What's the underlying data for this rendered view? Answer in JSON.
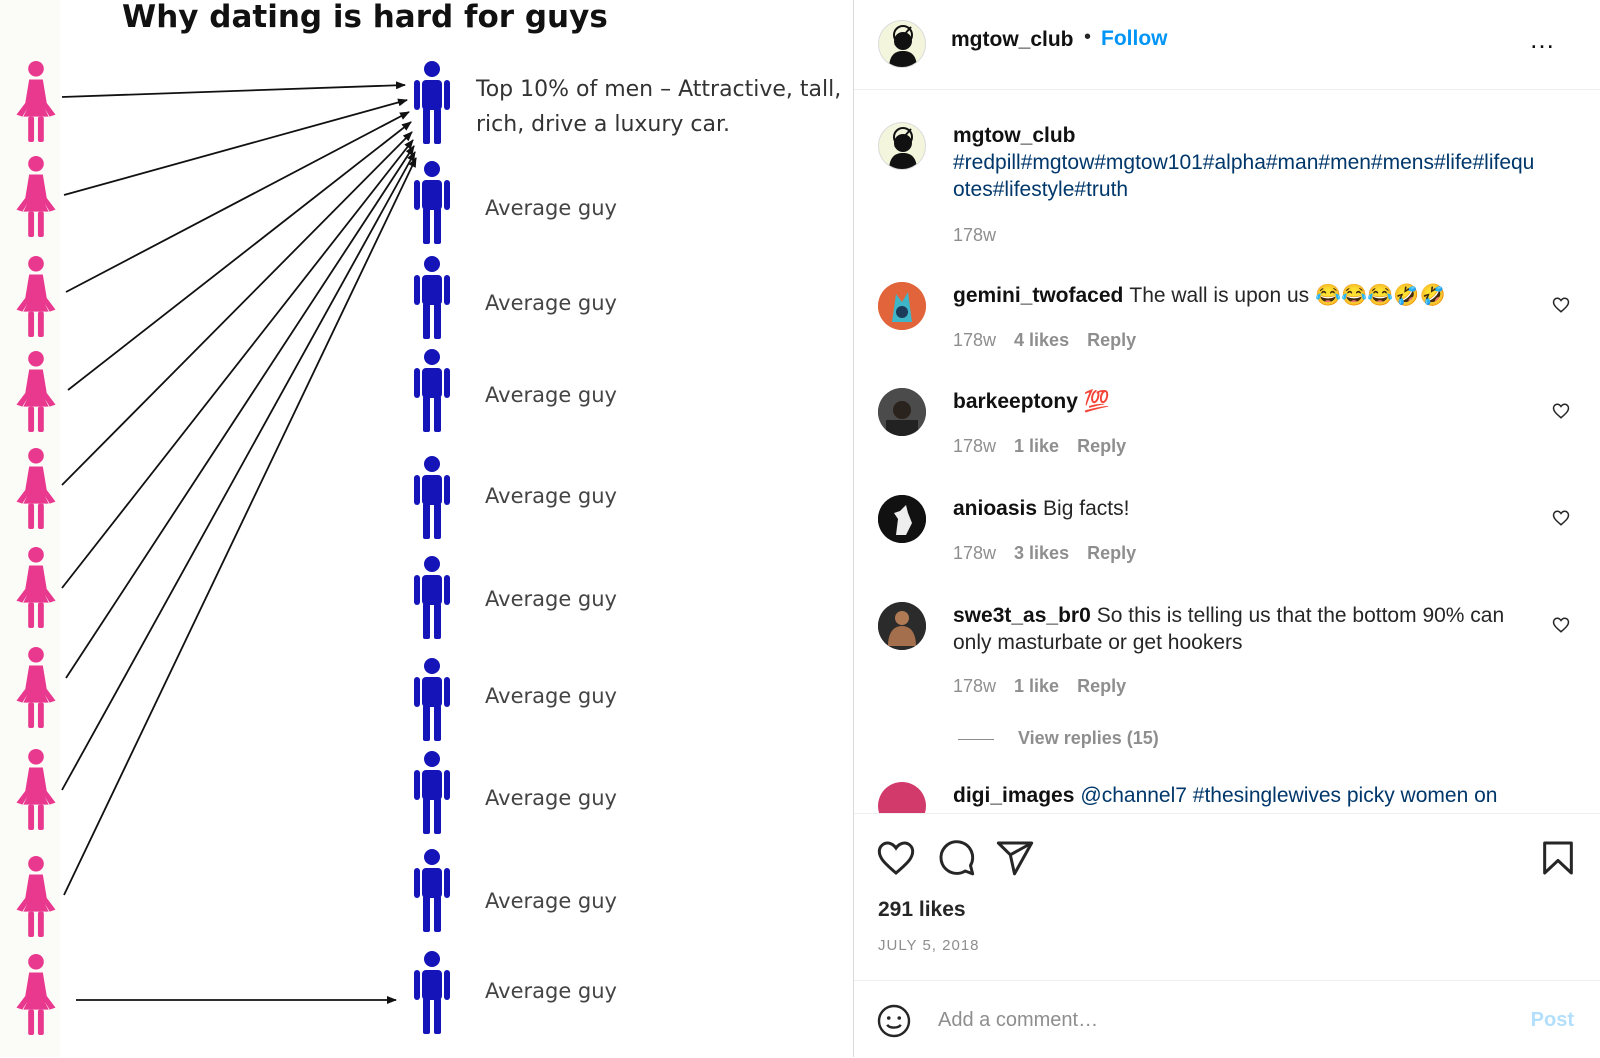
{
  "meme": {
    "title": "Why dating is hard for guys",
    "top_label_line1": "Top 10% of men – Attractive, tall,",
    "top_label_line2": "rich, drive a luxury car.",
    "average_label": "Average guy",
    "women_count": 10,
    "men_count": 10,
    "colors": {
      "women": "#e8398f",
      "men": "#1414b8"
    }
  },
  "header": {
    "username": "mgtow_club",
    "separator": "•",
    "follow_label": "Follow",
    "more_label": "…"
  },
  "caption": {
    "username": "mgtow_club",
    "hashtags": "#redpill#mgtow#mgtow101#alpha#man#men#mens#life#lifequotes#lifestyle#truth",
    "time": "178w"
  },
  "comments": [
    {
      "username": "gemini_twofaced",
      "text": "The wall is upon us 😂😂😂🤣🤣",
      "time": "178w",
      "likes": "4 likes",
      "reply": "Reply"
    },
    {
      "username": "barkeeptony",
      "text": "💯",
      "time": "178w",
      "likes": "1 like",
      "reply": "Reply"
    },
    {
      "username": "anioasis",
      "text": "Big facts!",
      "time": "178w",
      "likes": "3 likes",
      "reply": "Reply"
    },
    {
      "username": "swe3t_as_br0",
      "text": "So this is telling us that the bottom 90% can only masturbate or get hookers",
      "time": "178w",
      "likes": "1 like",
      "reply": "Reply"
    }
  ],
  "view_replies": "View replies (15)",
  "partial_comment": {
    "username": "digi_images",
    "text": "@channel7 #thesinglewives picky women on"
  },
  "actions": {
    "icons": [
      "heart-icon",
      "comment-icon",
      "share-icon",
      "bookmark-icon"
    ],
    "likes": "291 likes",
    "date": "JULY 5, 2018"
  },
  "add_comment": {
    "placeholder": "Add a comment…",
    "post_label": "Post"
  }
}
